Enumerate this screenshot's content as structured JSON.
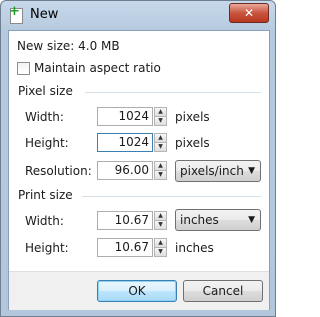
{
  "window": {
    "title": "New",
    "close_glyph": "✕",
    "app_icon": "new-image-icon"
  },
  "new_size": "New size: 4.0 MB",
  "maintain_aspect": {
    "label": "Maintain aspect ratio",
    "checked": false
  },
  "pixel_size": {
    "heading": "Pixel size",
    "width_label": "Width:",
    "width_value": "1024",
    "width_unit": "pixels",
    "height_label": "Height:",
    "height_value": "1024",
    "height_unit": "pixels",
    "resolution_label": "Resolution:",
    "resolution_value": "96.00",
    "resolution_unit": "pixels/inch"
  },
  "print_size": {
    "heading": "Print size",
    "width_label": "Width:",
    "width_value": "10.67",
    "width_unit": "inches",
    "height_label": "Height:",
    "height_value": "10.67",
    "height_unit": "inches"
  },
  "buttons": {
    "ok": "OK",
    "cancel": "Cancel"
  }
}
